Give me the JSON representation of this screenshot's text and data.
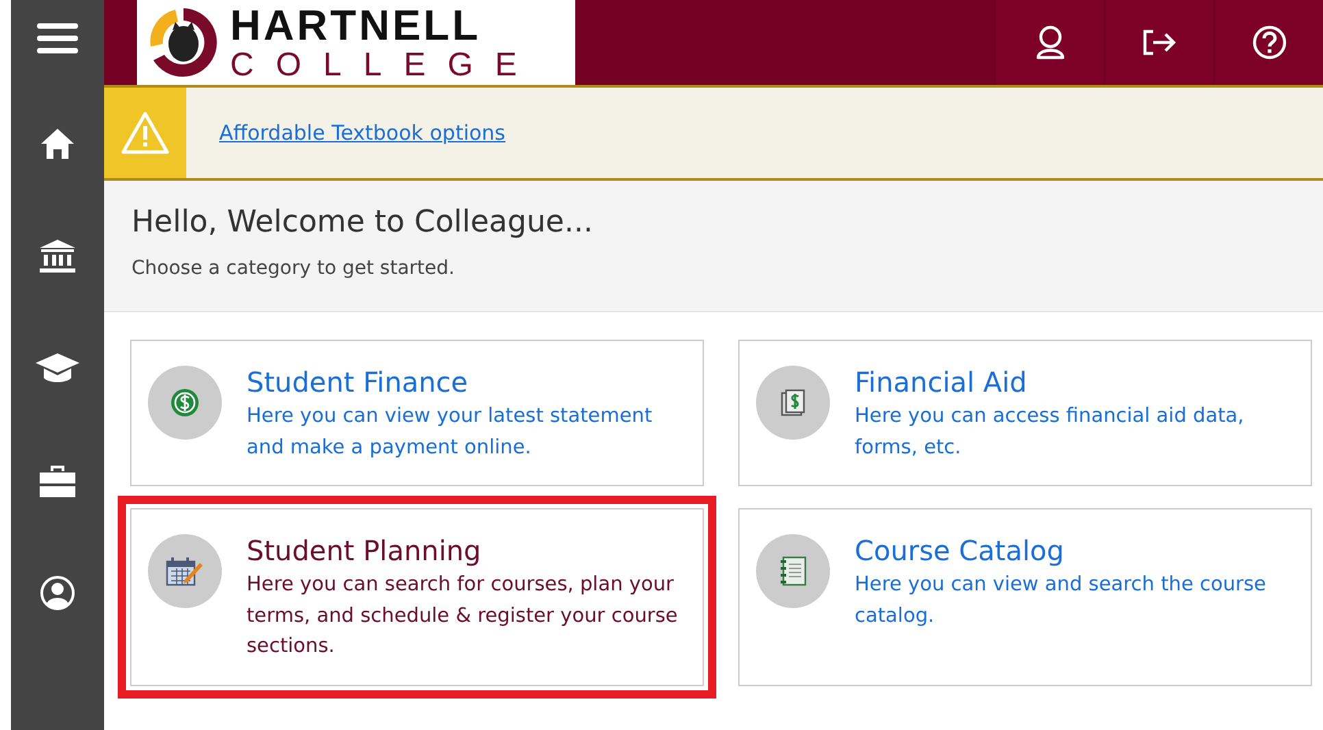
{
  "logo": {
    "line_1": "HARTNELL",
    "line_2": "COLLEGE"
  },
  "sidebar": {
    "items": [
      {
        "kind": "menu"
      },
      {
        "kind": "home"
      },
      {
        "kind": "bank"
      },
      {
        "kind": "graduation"
      },
      {
        "kind": "briefcase"
      },
      {
        "kind": "person"
      }
    ]
  },
  "header_buttons": [
    {
      "kind": "user"
    },
    {
      "kind": "signout"
    },
    {
      "kind": "help"
    }
  ],
  "alert": {
    "link": "Affordable Textbook options"
  },
  "welcome": {
    "title": "Hello, Welcome to Colleague...",
    "subtitle": "Choose a category to get started."
  },
  "tiles": [
    {
      "kind": "finance",
      "title": "Student Finance",
      "description": "Here you can view your latest statement and make a payment online.",
      "selected": false
    },
    {
      "kind": "aid",
      "title": "Financial Aid",
      "description": "Here you can access financial aid data, forms, etc.",
      "selected": false
    },
    {
      "kind": "planning",
      "title": "Student Planning",
      "description": "Here you can search for courses, plan your terms, and schedule & register your course sections.",
      "selected": true
    },
    {
      "kind": "catalog",
      "title": "Course Catalog",
      "description": "Here you can view and search the course catalog.",
      "selected": false
    }
  ]
}
